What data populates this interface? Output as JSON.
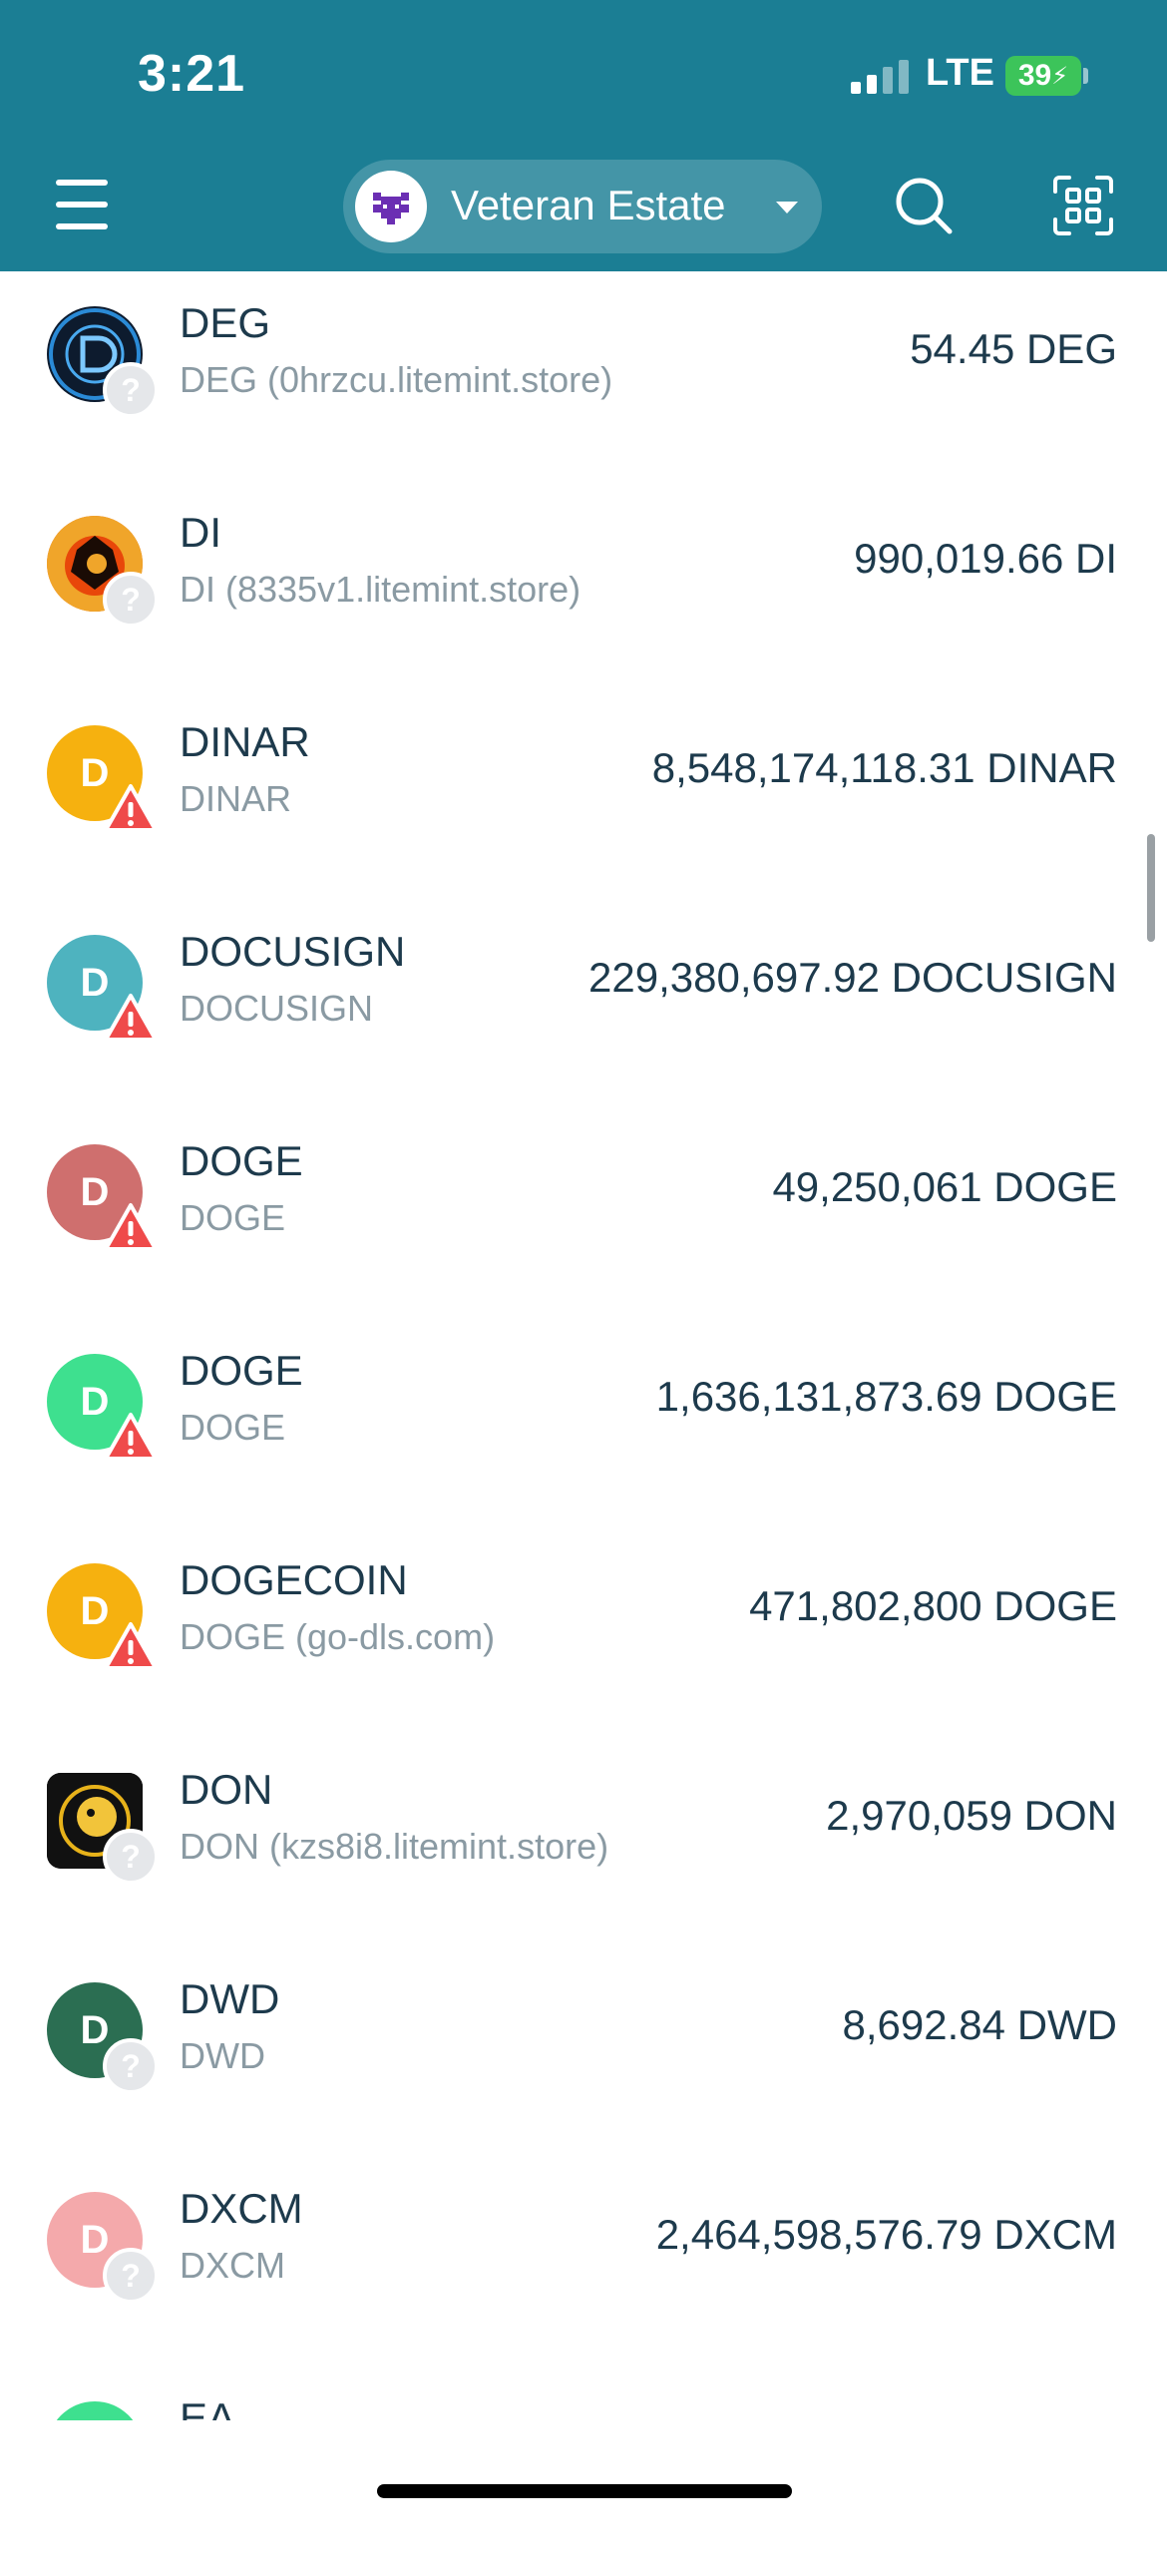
{
  "status_bar": {
    "time": "3:21",
    "network": "LTE",
    "battery": "39"
  },
  "header": {
    "wallet_name": "Veteran Estate"
  },
  "tokens": [
    {
      "symbol": "DEG",
      "subtitle": "DEG (0hrzcu.litemint.store)",
      "amount": "54.45 DEG",
      "icon_letter": "",
      "icon_color": "#0d1b2e",
      "badge": "unknown"
    },
    {
      "symbol": "DI",
      "subtitle": "DI (8335v1.litemint.store)",
      "amount": "990,019.66 DI",
      "icon_letter": "",
      "icon_color": "#e8700a",
      "badge": "unknown"
    },
    {
      "symbol": "DINAR",
      "subtitle": "DINAR",
      "amount": "8,548,174,118.31 DINAR",
      "icon_letter": "D",
      "icon_color": "#f6b10f",
      "badge": "warning"
    },
    {
      "symbol": "DOCUSIGN",
      "subtitle": "DOCUSIGN",
      "amount": "229,380,697.92 DOCUSIGN",
      "icon_letter": "D",
      "icon_color": "#4eb3bf",
      "badge": "warning"
    },
    {
      "symbol": "DOGE",
      "subtitle": "DOGE",
      "amount": "49,250,061 DOGE",
      "icon_letter": "D",
      "icon_color": "#cf6f6e",
      "badge": "warning"
    },
    {
      "symbol": "DOGE",
      "subtitle": "DOGE",
      "amount": "1,636,131,873.69 DOGE",
      "icon_letter": "D",
      "icon_color": "#3ee08f",
      "badge": "warning"
    },
    {
      "symbol": "DOGECOIN",
      "subtitle": "DOGE (go-dls.com)",
      "amount": "471,802,800 DOGE",
      "icon_letter": "D",
      "icon_color": "#f6b10f",
      "badge": "warning"
    },
    {
      "symbol": "DON",
      "subtitle": "DON (kzs8i8.litemint.store)",
      "amount": "2,970,059 DON",
      "icon_letter": "",
      "icon_color": "#111111",
      "badge": "unknown"
    },
    {
      "symbol": "DWD",
      "subtitle": "DWD",
      "amount": "8,692.84 DWD",
      "icon_letter": "D",
      "icon_color": "#2b6e52",
      "badge": "unknown"
    },
    {
      "symbol": "DXCM",
      "subtitle": "DXCM",
      "amount": "2,464,598,576.79 DXCM",
      "icon_letter": "D",
      "icon_color": "#f4a9ab",
      "badge": "unknown"
    },
    {
      "symbol": "EA",
      "subtitle": "",
      "amount": "",
      "icon_letter": "",
      "icon_color": "#3ee08f",
      "badge": "none"
    }
  ]
}
